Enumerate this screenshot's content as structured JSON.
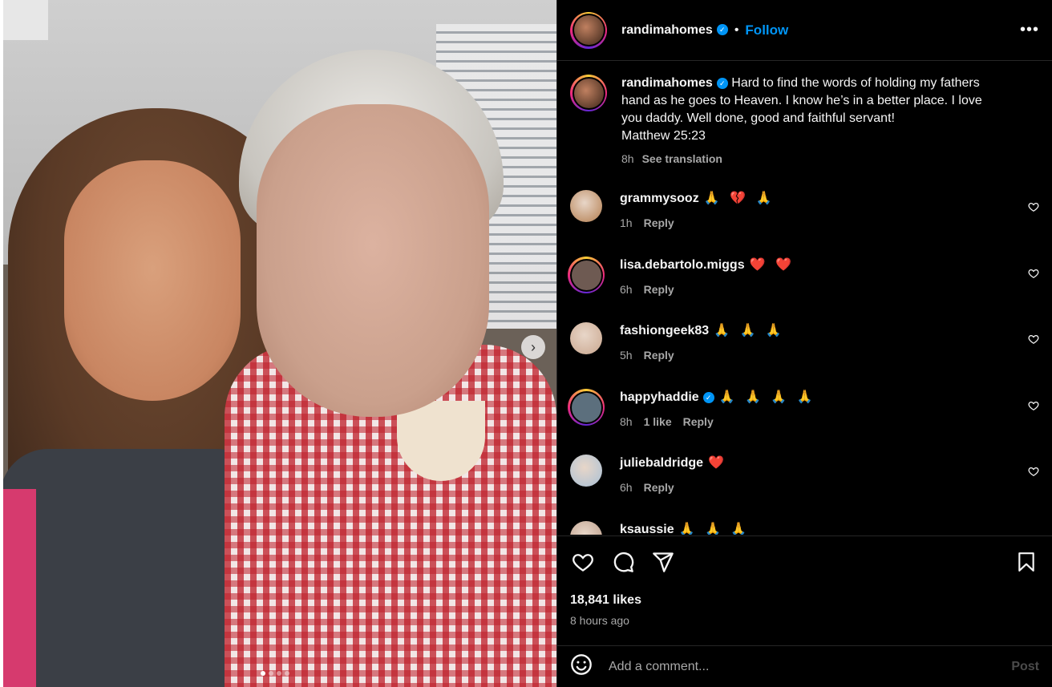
{
  "post": {
    "username": "randimahomes",
    "verified_icon": "verified-badge-icon",
    "separator": "•",
    "follow_label": "Follow",
    "more_label": "•••",
    "caption_lines": [
      "Hard to find the words of holding my fathers",
      "hand as he goes to Heaven. I know he’s in a better place. I love",
      "you daddy. Well done, good and faithful servant!",
      "Matthew 25:23"
    ],
    "caption_time": "8h",
    "see_translation": "See translation",
    "photo_next": "›",
    "carousel_dots": 4
  },
  "comments": [
    {
      "user": "grammysooz",
      "verified": false,
      "text": "🙏 💔 🙏",
      "time": "1h",
      "likes": "",
      "reply": "Reply",
      "ring": false,
      "avatar_color": "#b37d4e"
    },
    {
      "user": "lisa.debartolo.miggs",
      "verified": false,
      "text": "❤️ ❤️",
      "time": "6h",
      "likes": "",
      "reply": "Reply",
      "ring": true,
      "avatar_color": "#6e5a52"
    },
    {
      "user": "fashiongeek83",
      "verified": false,
      "text": "🙏 🙏 🙏",
      "time": "5h",
      "likes": "",
      "reply": "Reply",
      "ring": false,
      "avatar_color": "#c9a68e"
    },
    {
      "user": "happyhaddie",
      "verified": true,
      "text": "🙏 🙏 🙏 🙏",
      "time": "8h",
      "likes": "1 like",
      "reply": "Reply",
      "ring": true,
      "avatar_color": "#5c6f7d"
    },
    {
      "user": "juliebaldridge",
      "verified": false,
      "text": "❤️",
      "time": "6h",
      "likes": "",
      "reply": "Reply",
      "ring": false,
      "avatar_color": "#a8c0d6"
    },
    {
      "user": "ksaussie",
      "verified": false,
      "text": "🙏 🙏 🙏",
      "time": "",
      "likes": "",
      "reply": "",
      "ring": false,
      "avatar_color": "#b99a86"
    }
  ],
  "footer": {
    "likes": "18,841 likes",
    "posted": "8 hours ago",
    "comment_placeholder": "Add a comment...",
    "post_label": "Post",
    "icons": [
      "heart-icon",
      "comment-icon",
      "share-icon",
      "save-icon",
      "emoji-icon"
    ]
  }
}
